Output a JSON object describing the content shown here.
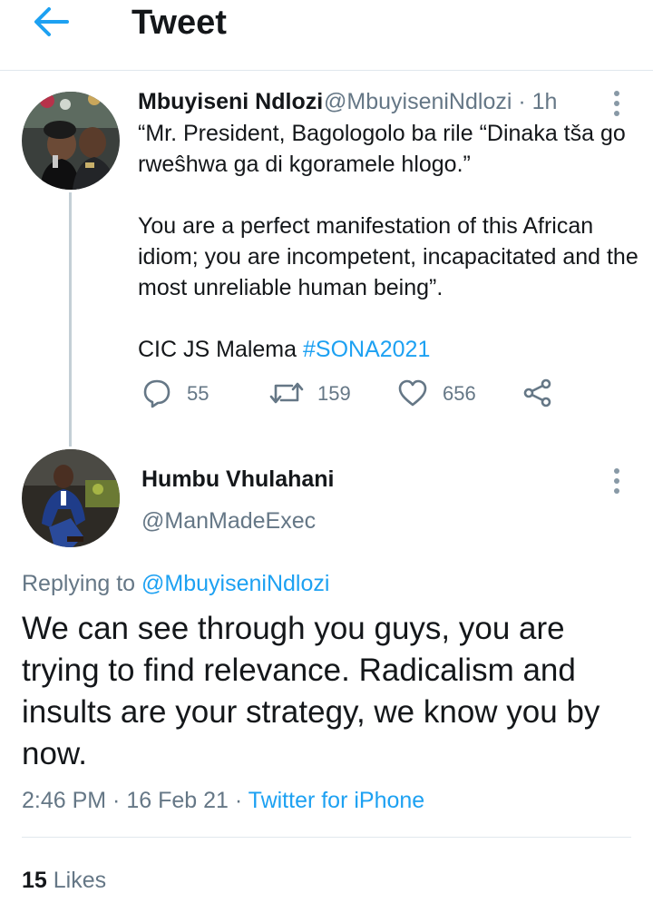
{
  "header": {
    "title": "Tweet",
    "back_icon": "arrow-left-icon",
    "accent": "#1da1f2"
  },
  "tweet": {
    "author_name": "Mbuyiseni Ndlozi",
    "handle_time": "@MbuyiseniNdlozi · 1h",
    "lines": {
      "l1": "“Mr. President, Bagologolo ba rile “Dinaka tša go rweŝhwa ga di kgoramele hlogo.”",
      "l2": "You are a perfect manifestation of this African idiom; you are incompetent, incapacitated and the most unreliable human being”.",
      "l3_prefix": "CIC JS Malema ",
      "l3_hashtag": "#SONA2021"
    },
    "replies": "55",
    "retweets": "159",
    "likes": "656"
  },
  "reply": {
    "author_name": "Humbu Vhulahani",
    "handle": "@ManMadeExec",
    "replying_prefix": "Replying to ",
    "replying_mention": "@MbuyiseniNdlozi",
    "text": "We can see through you guys, you are trying to find relevance. Radicalism and insults are your strategy, we know you by now.",
    "timestamp": "2:46 PM · 16 Feb 21 · ",
    "source": "Twitter for iPhone",
    "likes_count": "15",
    "likes_label": " Likes"
  },
  "colors": {
    "text": "#14171a",
    "secondary": "#657786",
    "link": "#1da1f2",
    "divider": "#e1e8ed"
  }
}
